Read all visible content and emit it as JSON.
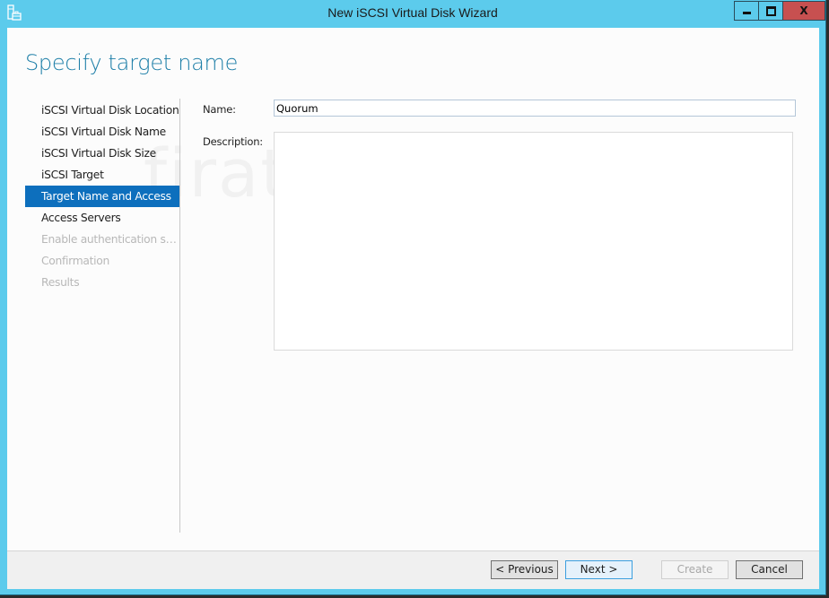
{
  "window": {
    "title": "New iSCSI Virtual Disk Wizard",
    "icon": "server-briefcase-icon",
    "controls": {
      "minimize": "minimize-icon",
      "maximize": "maximize-icon",
      "close": "close-icon",
      "close_glyph": "X"
    },
    "colors": {
      "frame": "#5ccbec",
      "close_button": "#c75050",
      "accent": "#0d6fbd",
      "title_text": "#1e7fa8"
    }
  },
  "watermark": "firatboyan.com",
  "page": {
    "title": "Specify target name"
  },
  "nav": {
    "items": [
      {
        "label": "iSCSI Virtual Disk Location",
        "state": "completed"
      },
      {
        "label": "iSCSI Virtual Disk Name",
        "state": "completed"
      },
      {
        "label": "iSCSI Virtual Disk Size",
        "state": "completed"
      },
      {
        "label": "iSCSI Target",
        "state": "completed"
      },
      {
        "label": "Target Name and Access",
        "state": "active"
      },
      {
        "label": "Access Servers",
        "state": "enabled"
      },
      {
        "label": "Enable authentication ser...",
        "state": "disabled"
      },
      {
        "label": "Confirmation",
        "state": "disabled"
      },
      {
        "label": "Results",
        "state": "disabled"
      }
    ]
  },
  "form": {
    "name_label": "Name:",
    "name_value": "Quorum",
    "description_label": "Description:",
    "description_value": ""
  },
  "footer": {
    "previous_label": "< Previous",
    "next_label": "Next >",
    "create_label": "Create",
    "cancel_label": "Cancel"
  }
}
